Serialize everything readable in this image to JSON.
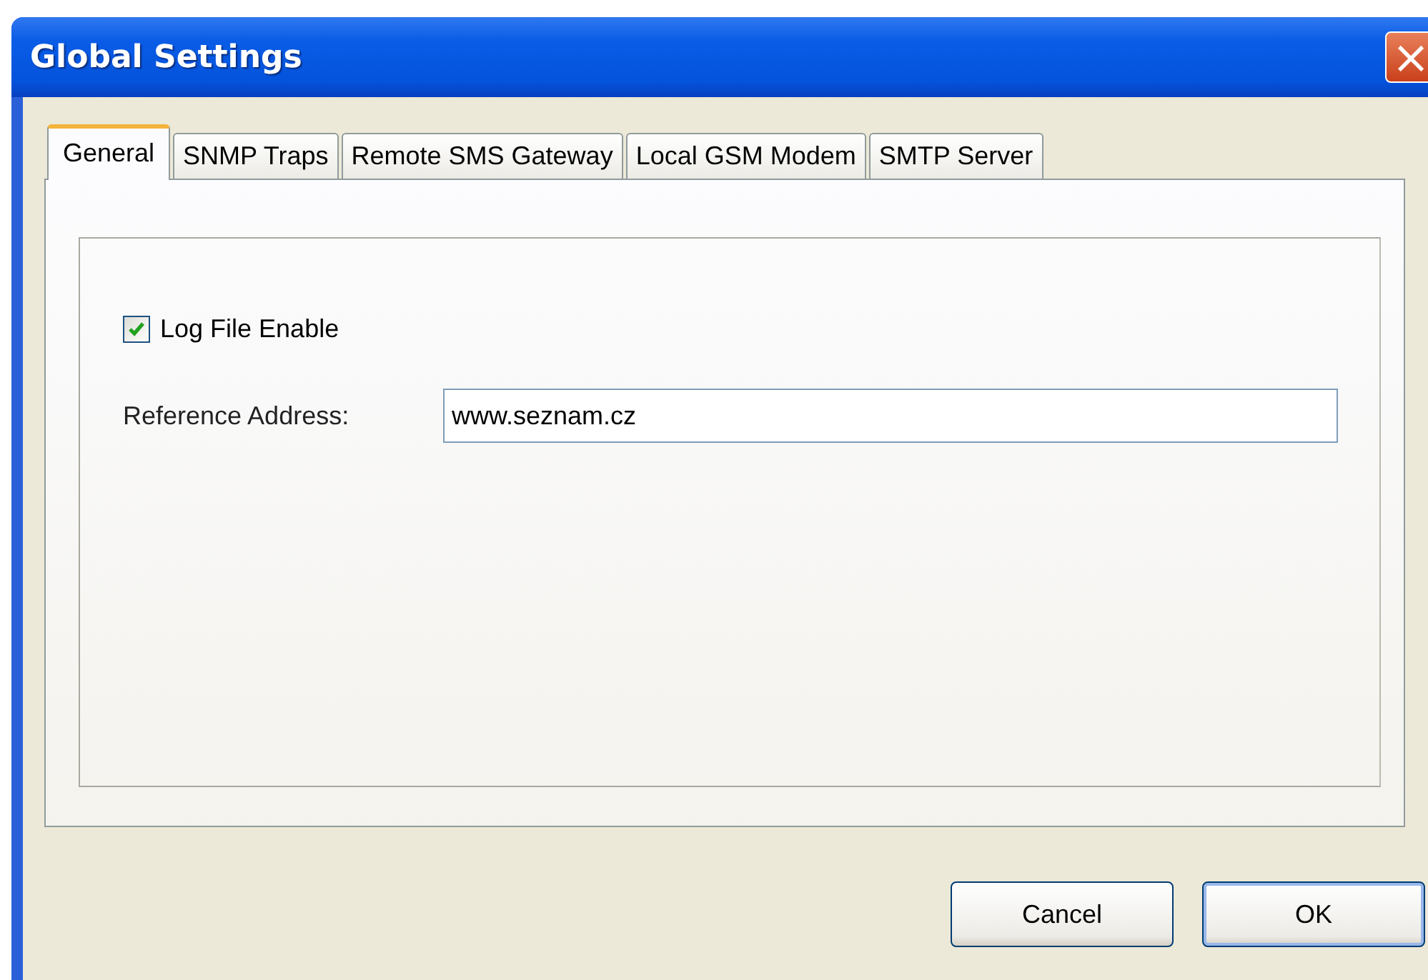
{
  "window": {
    "title": "Global Settings",
    "close_icon": "×"
  },
  "tabs": [
    {
      "label": "General",
      "selected": true
    },
    {
      "label": "SNMP Traps",
      "selected": false
    },
    {
      "label": "Remote SMS Gateway",
      "selected": false
    },
    {
      "label": "Local GSM Modem",
      "selected": false
    },
    {
      "label": "SMTP Server",
      "selected": false
    }
  ],
  "general": {
    "log_file_enable": {
      "label": "Log File Enable",
      "checked": true
    },
    "reference_address": {
      "label": "Reference Address:",
      "value": "www.seznam.cz"
    }
  },
  "buttons": [
    {
      "label": "Cancel",
      "default": false
    },
    {
      "label": "OK",
      "default": true
    }
  ]
}
